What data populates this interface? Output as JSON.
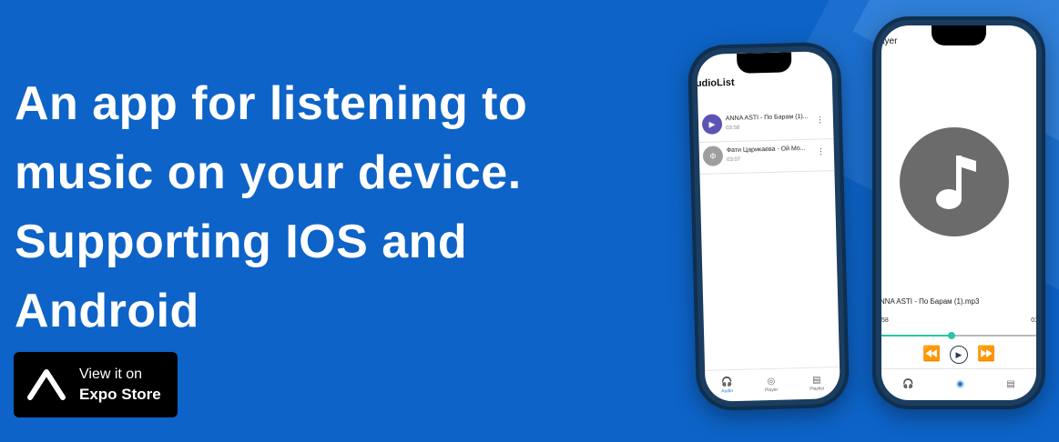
{
  "headline": "An app for listening to music on your device. Supporting IOS and Android",
  "store": {
    "small": "View it on",
    "big": "Expo Store"
  },
  "phone1": {
    "app_title": "udioList",
    "tracks": [
      {
        "title": "ANNA ASTI - По Барам (1)...",
        "duration": "03:58",
        "avatar": "▶",
        "avatar_color": "#5b54b6"
      },
      {
        "title": "Фати Царикаева - Ой Мо...",
        "duration": "03:07",
        "avatar": "Ф",
        "avatar_color": "#9e9e9e"
      }
    ],
    "nav": [
      {
        "icon": "🎧",
        "label": "Audio",
        "active": true
      },
      {
        "icon": "◎",
        "label": "Player",
        "active": false
      },
      {
        "icon": "▤",
        "label": "Playlist",
        "active": false
      }
    ]
  },
  "phone2": {
    "app_title": "ayer",
    "now_playing": "NNA ASTI - По Барам (1).mp3",
    "time_left": "58",
    "time_right": "01",
    "progress": 0.45,
    "nav": [
      {
        "icon": "🎧",
        "label": "",
        "active": false
      },
      {
        "icon": "◉",
        "label": "",
        "active": true
      },
      {
        "icon": "▤",
        "label": "",
        "active": false
      }
    ]
  },
  "colors": {
    "background": "#0d63c7",
    "accent": "#26c6a6"
  }
}
